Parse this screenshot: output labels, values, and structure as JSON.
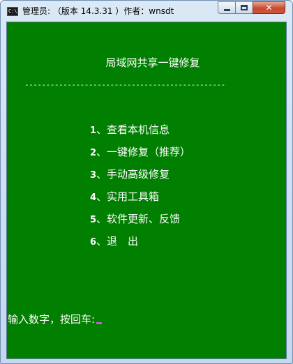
{
  "window": {
    "title": "管理员: （版本 14.3.31 ）作者：wnsdt",
    "app_icon_text": "C:\\",
    "close_glyph": "✕"
  },
  "console": {
    "heading": "局域网共享一键修复",
    "divider": "-----------------------------------------------",
    "menu": [
      {
        "num": "1",
        "label": "、查看本机信息"
      },
      {
        "num": "2",
        "label": "、一键修复（推荐）"
      },
      {
        "num": "3",
        "label": "、手动高级修复"
      },
      {
        "num": "4",
        "label": "、实用工具箱"
      },
      {
        "num": "5",
        "label": "、软件更新、反馈"
      },
      {
        "num": "6",
        "label": "、退　出"
      }
    ],
    "prompt": "输入数字，按回车:",
    "colors": {
      "background": "#007f00",
      "text": "#ffffff",
      "cursor": "#c85ac8"
    }
  }
}
